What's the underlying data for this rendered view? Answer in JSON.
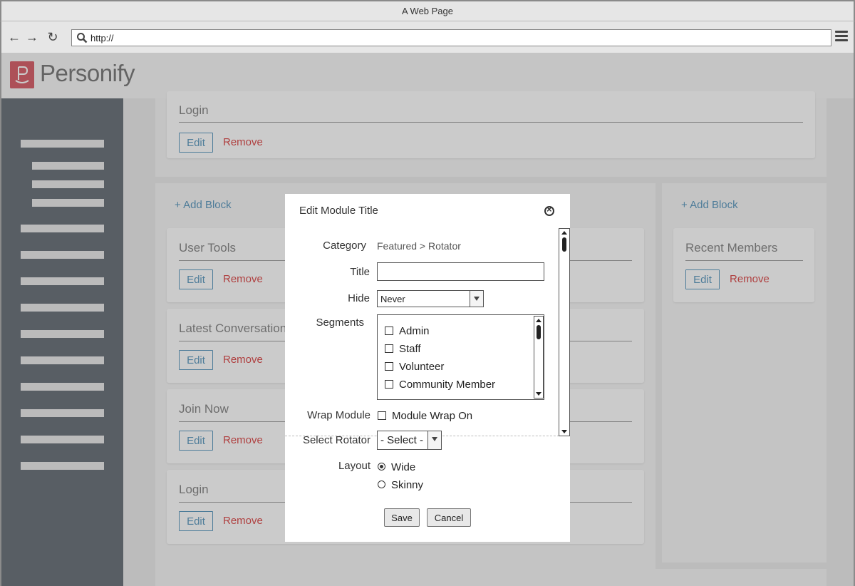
{
  "browser": {
    "window_title": "A Web Page",
    "url": "http://"
  },
  "app": {
    "logo_text": "Personify",
    "brand_color": "#c8202f",
    "sidebar_color": "#2e3a44"
  },
  "top_section": {
    "card_title": "Login",
    "edit_label": "Edit",
    "remove_label": "Remove"
  },
  "left_column": {
    "add_block_label": "+ Add Block",
    "cards": [
      {
        "title": "User Tools",
        "edit_label": "Edit",
        "remove_label": "Remove"
      },
      {
        "title": "Latest Conversation",
        "edit_label": "Edit",
        "remove_label": "Remove"
      },
      {
        "title": "Join Now",
        "edit_label": "Edit",
        "remove_label": "Remove"
      },
      {
        "title": "Login",
        "edit_label": "Edit",
        "remove_label": "Remove"
      }
    ]
  },
  "right_column": {
    "add_block_label": "+ Add Block",
    "cards": [
      {
        "title": "Recent Members",
        "edit_label": "Edit",
        "remove_label": "Remove"
      }
    ]
  },
  "modal": {
    "title": "Edit Module Title",
    "category_label": "Category",
    "category_value": "Featured > Rotator",
    "title_label": "Title",
    "title_value": "",
    "hide_label": "Hide",
    "hide_value": "Never",
    "segments_label": "Segments",
    "segments": [
      {
        "label": "Admin",
        "checked": false
      },
      {
        "label": "Staff",
        "checked": false
      },
      {
        "label": "Volunteer",
        "checked": false
      },
      {
        "label": "Community Member",
        "checked": false
      }
    ],
    "wrap_label": "Wrap Module",
    "wrap_option": "Module Wrap On",
    "rotator_label": "Select Rotator",
    "rotator_value": "- Select -",
    "layout_label": "Layout",
    "layout_options": [
      {
        "label": "Wide",
        "selected": true
      },
      {
        "label": "Skinny",
        "selected": false
      }
    ],
    "save_label": "Save",
    "cancel_label": "Cancel"
  }
}
